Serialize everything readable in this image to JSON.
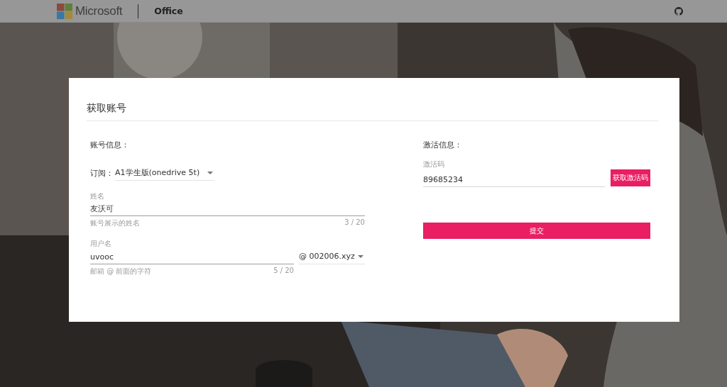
{
  "header": {
    "brand": "Microsoft",
    "product": "Office"
  },
  "dialog": {
    "title": "获取账号",
    "account": {
      "heading": "账号信息：",
      "subscription": {
        "label": "订阅：",
        "value": "A1学生版(onedrive 5t)"
      },
      "name": {
        "label": "姓名",
        "value": "友沃可",
        "hint": "账号展示的姓名",
        "counter": "3 / 20"
      },
      "username": {
        "label": "用户名",
        "value": "uvooc",
        "hint": "邮箱 @ 前面的字符",
        "counter": "5 / 20",
        "domain": "@ 002006.xyz"
      }
    },
    "activation": {
      "heading": "激活信息：",
      "code": {
        "label": "激活码",
        "value": "89685234"
      },
      "get_code_button": "获取激活码"
    },
    "submit_button": "提交"
  }
}
